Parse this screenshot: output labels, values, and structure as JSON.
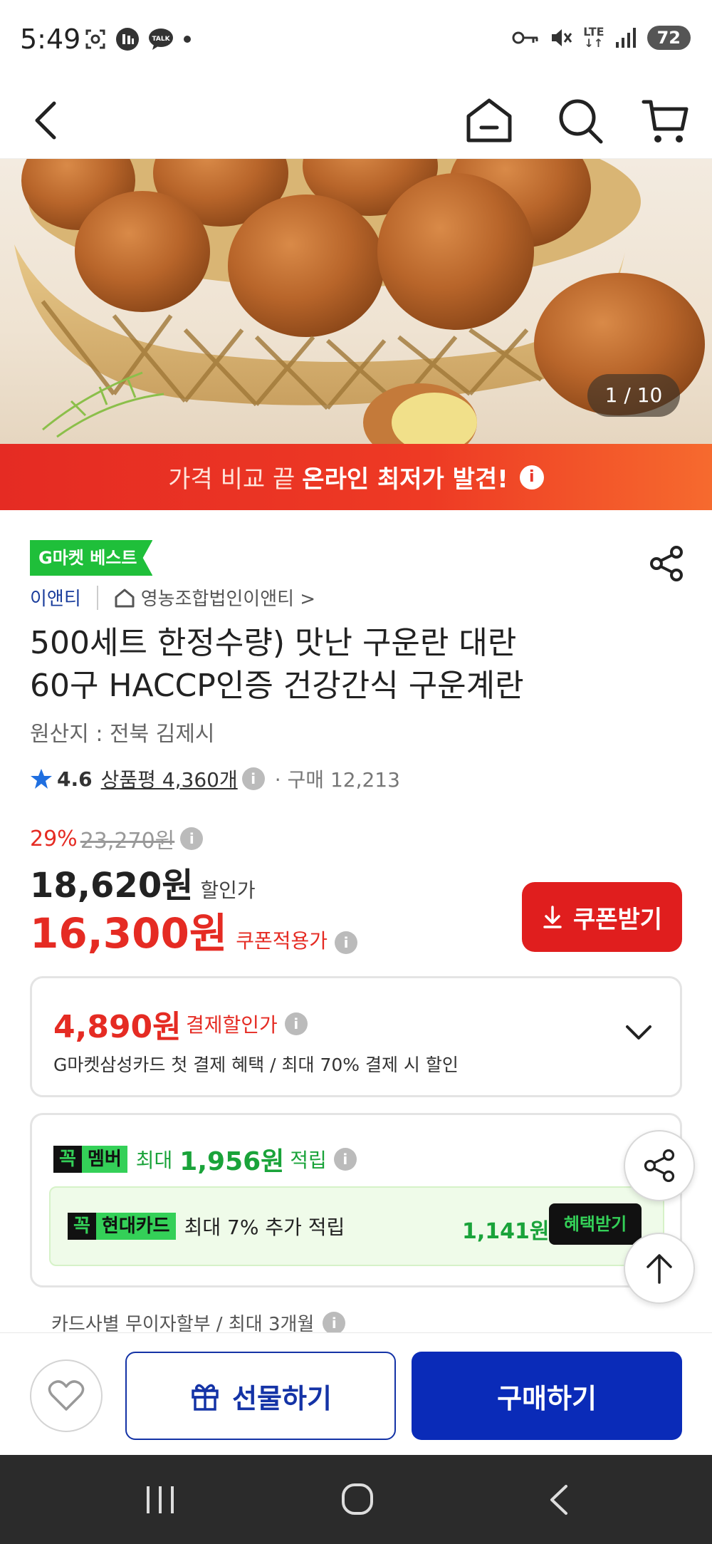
{
  "status_bar": {
    "time": "5:49",
    "left_icons": [
      "screenshot-icon",
      "app-icon",
      "kakaotalk-icon",
      "dot-icon"
    ],
    "lte": "LTE",
    "battery": "72",
    "right_icons": [
      "key-icon",
      "mute-icon",
      "lte-icon",
      "signal-icon",
      "battery-icon"
    ]
  },
  "top_nav": {
    "icons": [
      "back-icon",
      "home-icon",
      "search-icon",
      "cart-icon"
    ]
  },
  "hero": {
    "counter": "1 / 10"
  },
  "banner": {
    "light_text": "가격 비교 끝",
    "bold_text": "온라인 최저가 발견!",
    "info": "i"
  },
  "product": {
    "badge": "G마켓 베스트",
    "seller": "이앤티",
    "shop": "영농조합법인이앤티 >",
    "title_line1": "500세트 한정수량) 맛난 구운란 대란",
    "title_line2": "60구 HACCP인증 건강간식 구운계란",
    "origin": "원산지 : 전북 김제시",
    "rating": "4.6",
    "review": "상품평 4,360개",
    "purchase": "· 구매 12,213"
  },
  "price": {
    "discount_rate": "29%",
    "original": "23,270원",
    "sale": "18,620원",
    "sale_label": "할인가",
    "coupon_price": "16,300원",
    "coupon_label": "쿠폰적용가",
    "coupon_button": "쿠폰받기"
  },
  "payment": {
    "price": "4,890원",
    "label": "결제할인가",
    "desc": "G마켓삼성카드 첫 결제 혜택 / 최대 70% 결제 시 할인"
  },
  "member": {
    "badge_a": "꼭",
    "badge_b": "멤버",
    "max": "최대",
    "amount": "1,956원",
    "earn": "적립",
    "card_badge_b": "현대카드",
    "card_desc": "최대 7% 추가 적립",
    "card_amount": "1,141원",
    "benefit_button": "혜택받기"
  },
  "installment": "카드사별 무이자할부 / 최대 3개월",
  "actions": {
    "gift": "선물하기",
    "buy": "구매하기"
  },
  "colors": {
    "accent_red": "#e52b23",
    "brand_green": "#1fbf3a",
    "buy_blue": "#0a2bb8",
    "seller_blue": "#1a3d9c"
  }
}
